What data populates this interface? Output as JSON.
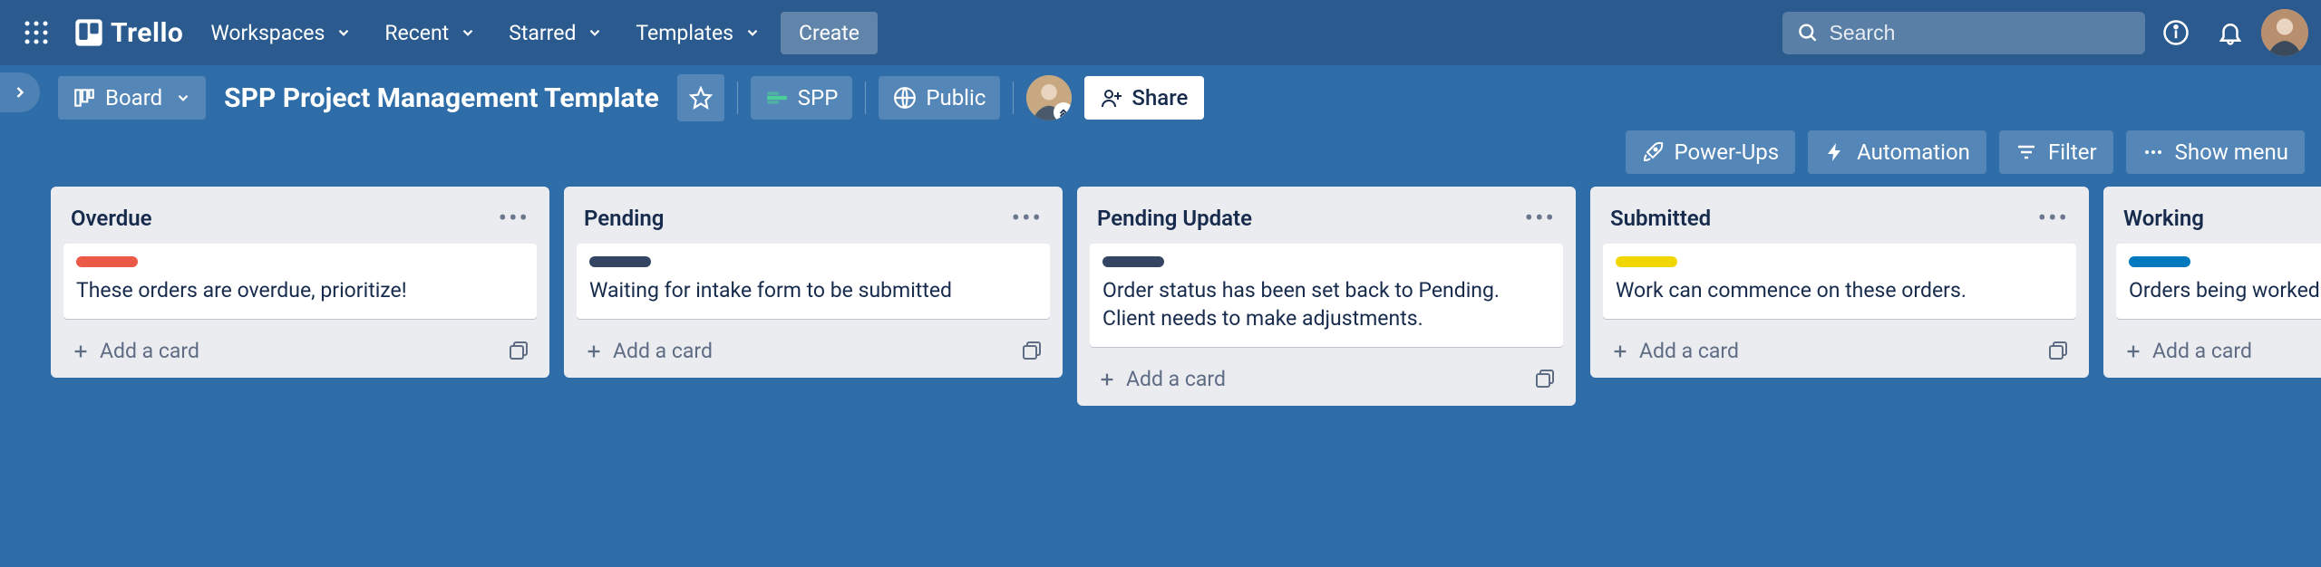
{
  "colors": {
    "label_red": "#eb5a46",
    "label_navy": "#344563",
    "label_yellow": "#f2d600",
    "label_blue": "#0079bf"
  },
  "topbar": {
    "logo": "Trello",
    "menus": {
      "workspaces": "Workspaces",
      "recent": "Recent",
      "starred": "Starred",
      "templates": "Templates"
    },
    "create": "Create",
    "search_placeholder": "Search"
  },
  "boardbar": {
    "view_label": "Board",
    "title": "SPP Project Management Template",
    "workspace_badge": "SPP",
    "visibility": "Public",
    "share": "Share"
  },
  "secondbar": {
    "powerups": "Power-Ups",
    "automation": "Automation",
    "filter": "Filter",
    "show_menu": "Show menu"
  },
  "add_card_label": "Add a card",
  "lists": [
    {
      "title": "Overdue",
      "cards": [
        {
          "label_color": "label_red",
          "text": "These orders are overdue, prioritize!"
        }
      ]
    },
    {
      "title": "Pending",
      "cards": [
        {
          "label_color": "label_navy",
          "text": "Waiting for intake form to be submitted"
        }
      ]
    },
    {
      "title": "Pending Update",
      "cards": [
        {
          "label_color": "label_navy",
          "text": "Order status has been set back to Pending. Client needs to make adjustments."
        }
      ]
    },
    {
      "title": "Submitted",
      "cards": [
        {
          "label_color": "label_yellow",
          "text": "Work can commence on these orders."
        }
      ]
    },
    {
      "title": "Working",
      "cards": [
        {
          "label_color": "label_blue",
          "text": "Orders being worked on."
        }
      ]
    }
  ]
}
